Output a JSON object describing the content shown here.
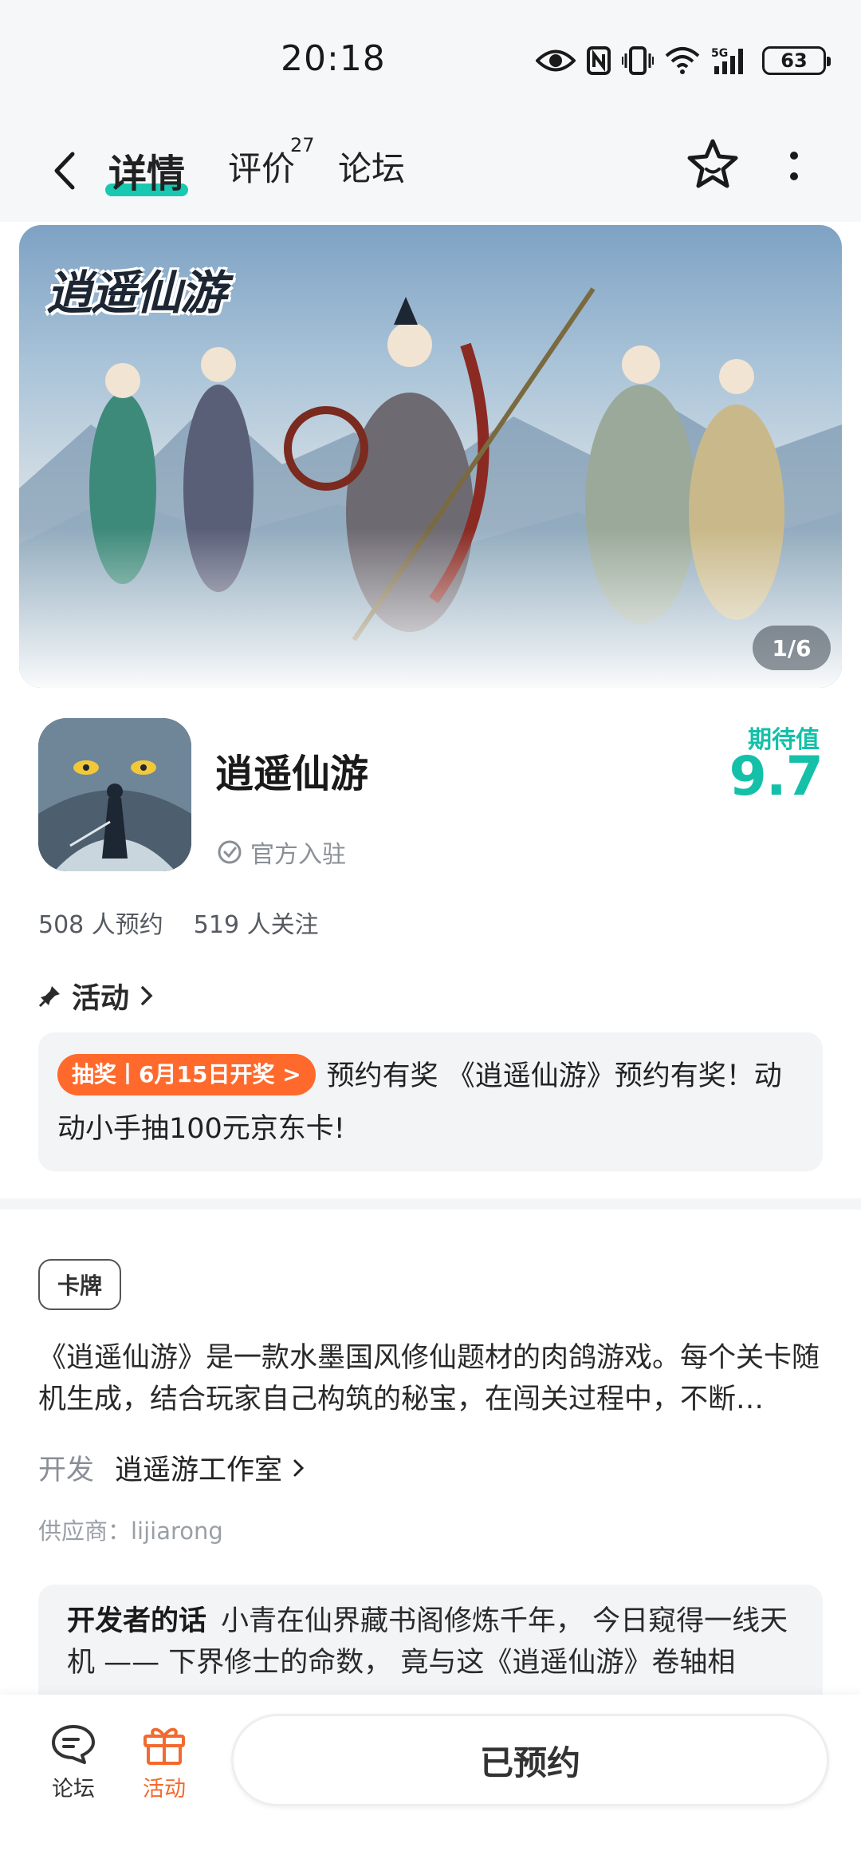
{
  "status_bar": {
    "time": "20:18",
    "battery": "63"
  },
  "nav": {
    "tabs": [
      {
        "label": "详情",
        "active": true
      },
      {
        "label": "评价",
        "badge": "27"
      },
      {
        "label": "论坛"
      }
    ],
    "icons": [
      "back-arrow-icon",
      "star-icon",
      "more-vertical-icon"
    ]
  },
  "banner": {
    "logo_text": "逍遥仙游",
    "page_indicator": "1/6"
  },
  "game": {
    "name": "逍遥仙游",
    "official": "官方入驻",
    "expect_label": "期待值",
    "expect_value": "9.7",
    "reservations": "508 人预约",
    "followers": "519 人关注"
  },
  "activity": {
    "heading": "活动",
    "badge": "抽奖丨6月15日开奖 >",
    "text": "预约有奖 《逍遥仙游》预约有奖！动动小手抽100元京东卡!"
  },
  "details": {
    "tag": "卡牌",
    "description": "《逍遥仙游》是一款水墨国风修仙题材的肉鸽游戏。每个关卡随机生成，结合玩家自己构筑的秘宝，在闯关过程中，不断…",
    "developer_label": "开发",
    "developer": "逍遥游工作室",
    "supplier": "供应商：lijiarong",
    "dev_words_label": "开发者的话",
    "dev_words": "小青在仙界藏书阁修炼千年， 今日窥得一线天机 —— 下界修士的命数， 竟与这《逍遥仙游》卷轴相"
  },
  "bottom_bar": {
    "forum_label": "论坛",
    "activity_label": "活动",
    "reserve_button": "已预约"
  },
  "colors": {
    "accent": "#14c0a8",
    "activity_orange": "#ff6a2c"
  }
}
